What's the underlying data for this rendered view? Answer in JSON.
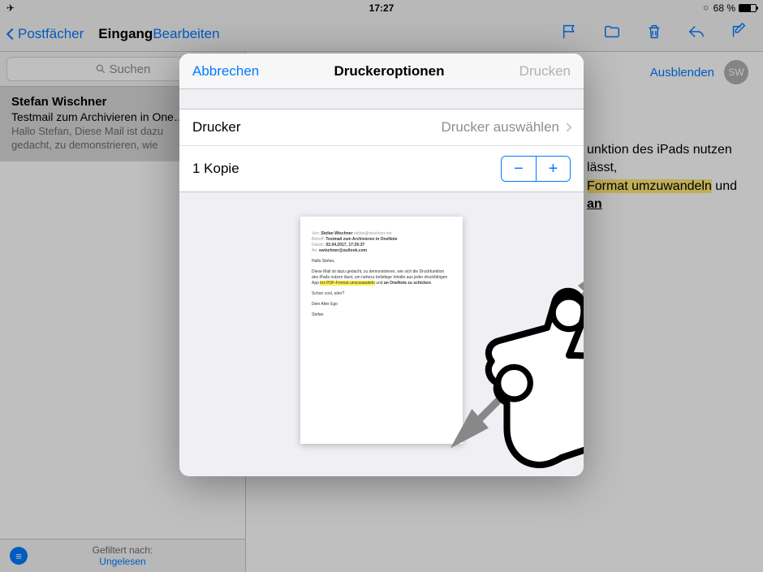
{
  "status": {
    "time": "17:27",
    "battery_pct": "68 %"
  },
  "nav": {
    "back_label": "Postfächer",
    "inbox_title": "Eingang",
    "edit_label": "Bearbeiten"
  },
  "search": {
    "placeholder": "Suchen"
  },
  "message": {
    "sender": "Stefan Wischner",
    "subject": "Testmail zum Archivieren in One…",
    "preview_line1": "Hallo Stefan, Diese Mail ist dazu",
    "preview_line2": "gedacht, zu demonstrieren, wie"
  },
  "filter": {
    "label": "Gefiltert nach:",
    "value": "Ungelesen"
  },
  "content": {
    "hide_label": "Ausblenden",
    "avatar_initials": "SW",
    "body_fragment1": "unktion des iPads nutzen lässt,",
    "body_hl": "Format umzuwandeln",
    "body_mid": " und ",
    "body_ul": "an"
  },
  "modal": {
    "cancel": "Abbrechen",
    "title": "Druckeroptionen",
    "print": "Drucken",
    "printer_label": "Drucker",
    "printer_value": "Drucker auswählen",
    "copies_label": "1 Kopie"
  },
  "preview_doc": {
    "from_label": "Von:",
    "from_value": "Stefan Wischner",
    "from_email": "stefan@wischner.net",
    "subject_label": "Betreff:",
    "subject_value": "Testmail zum Archivieren in OneNote",
    "date_label": "Datum:",
    "date_value": "02.04.2017, 17:26:37",
    "to_label": "An:",
    "to_value": "swischner@outlook.com",
    "greeting": "Hallo Stefan,",
    "body1a": "Diese Mail ist dazu gedacht, zu demonstrieren, wie sich die Druckfunktion des iPads nutzen lässt, um nahezu beliebige Inhalte aus jeder druckfähigen App ",
    "body_hl1": "ins PDF-Format umzuwandeln",
    "body_mid": " und ",
    "body_hl2": "an OneNote zu schicken",
    "body1b": ".",
    "line2": "Schon cool, oder?",
    "line3": "Dein Alter Ego",
    "line4": "Stefan"
  }
}
